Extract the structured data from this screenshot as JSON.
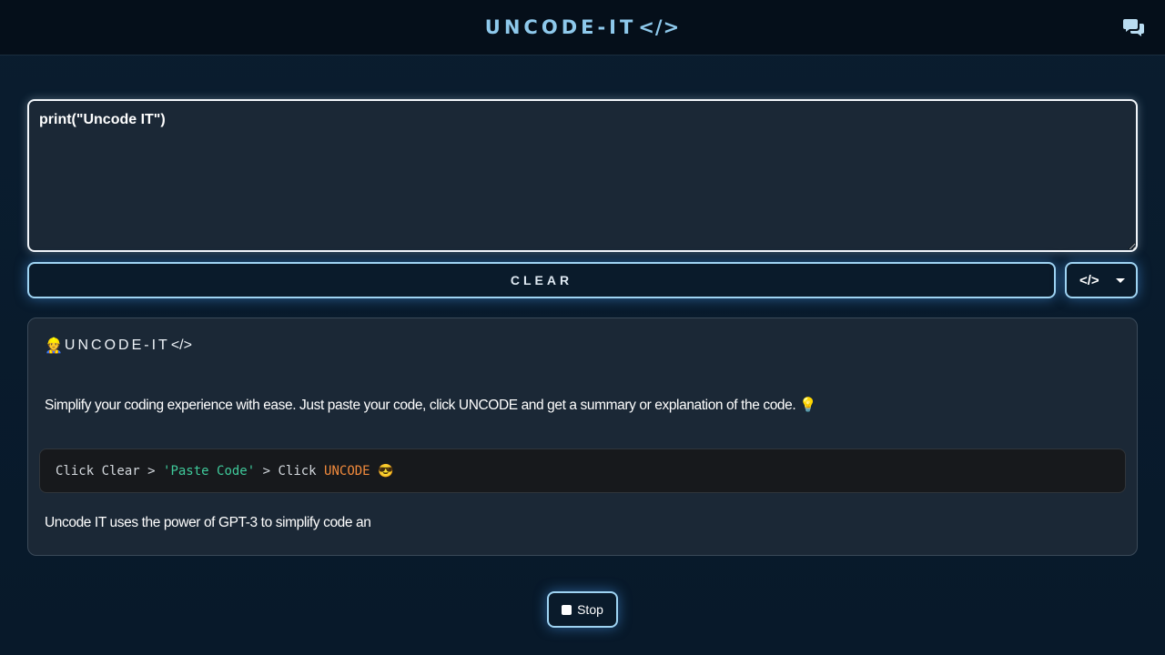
{
  "header": {
    "title": "UNCODE-IT",
    "title_tag": "</>",
    "chat_icon": "chat-bubbles-icon"
  },
  "editor": {
    "value": "print(\"Uncode IT\")"
  },
  "controls": {
    "clear_label": "CLEAR",
    "language_symbol": "</>",
    "language_caret_icon": "chevron-down-icon"
  },
  "card": {
    "title_emoji": "👷",
    "title": "UNCODE-IT",
    "title_tag": "</>",
    "description": "Simplify your coding experience with ease. Just paste your code, click UNCODE and get a summary or explanation of the code. 💡",
    "code": {
      "part1": "Click Clear > ",
      "string": "'Paste Code'",
      "part2": " > Click ",
      "keyword": "UNCODE",
      "part3": " 😎"
    },
    "footer": "Uncode IT uses the power of GPT-3 to simplify code an"
  },
  "stop": {
    "label": "Stop",
    "icon": "stop-square-icon"
  },
  "colors": {
    "accent": "#9fd4f3",
    "brand": "#8ec9ec",
    "background": "#0a1d2f",
    "card": "#1b2836",
    "code_string": "#3fc99a",
    "code_keyword": "#f28a3c"
  }
}
